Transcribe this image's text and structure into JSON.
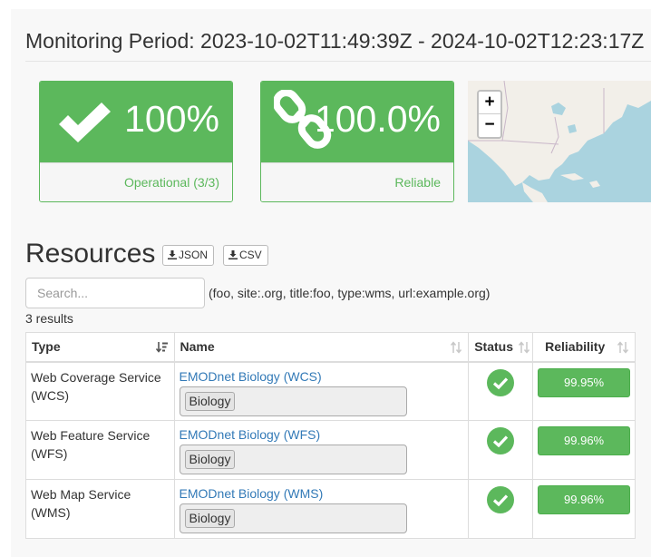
{
  "header": {
    "period_label": "Monitoring Period: 2023-10-02T11:49:39Z - 2024-10-02T12:23:17Z"
  },
  "panels": [
    {
      "value": "100%",
      "footer": "Operational (3/3)",
      "icon": "check-icon"
    },
    {
      "value": "100.0%",
      "footer": "Reliable",
      "icon": "link-icon"
    }
  ],
  "map": {
    "zoom_in": "+",
    "zoom_out": "−"
  },
  "resources": {
    "title": "Resources",
    "json_label": "JSON",
    "csv_label": "CSV",
    "search_placeholder": "Search...",
    "search_hint": "(foo, site:.org, title:foo, type:wms, url:example.org)",
    "results_count": "3 results",
    "columns": [
      "Type",
      "Name",
      "Status",
      "Reliability"
    ],
    "rows": [
      {
        "type": "Web Coverage Service (WCS)",
        "name": "EMODnet Biology (WCS)",
        "tag": "Biology",
        "reliability": "99.95%"
      },
      {
        "type": "Web Feature Service (WFS)",
        "name": "EMODnet Biology (WFS)",
        "tag": "Biology",
        "reliability": "99.96%"
      },
      {
        "type": "Web Map Service (WMS)",
        "name": "EMODnet Biology (WMS)",
        "tag": "Biology",
        "reliability": "99.96%"
      }
    ]
  },
  "colors": {
    "success": "#5cb85c",
    "link": "#337ab7",
    "water": "#aad3df",
    "land": "#f2efe9"
  }
}
